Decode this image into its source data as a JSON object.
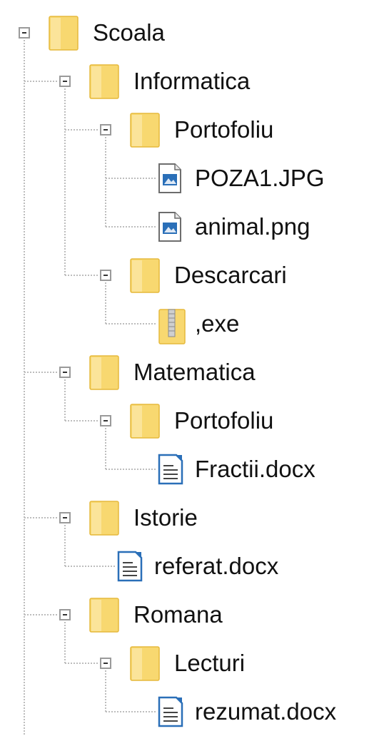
{
  "colors": {
    "folder": "#f8d870",
    "folder_dark": "#e6b93c",
    "tree_line": "#bdbdbd",
    "expander_border": "#9a9a9a",
    "text": "#111111",
    "image_icon": "#2a6fb8",
    "doc_icon": "#2a6fb8"
  },
  "tree": [
    {
      "label": "Scoala",
      "type": "folder",
      "depth": 0,
      "expanded": true
    },
    {
      "label": "Informatica",
      "type": "folder",
      "depth": 1,
      "expanded": true
    },
    {
      "label": "Portofoliu",
      "type": "folder",
      "depth": 2,
      "expanded": true
    },
    {
      "label": "POZA1.JPG",
      "type": "image",
      "depth": 3
    },
    {
      "label": "animal.png",
      "type": "image",
      "depth": 3
    },
    {
      "label": "Descarcari",
      "type": "folder",
      "depth": 2,
      "expanded": true
    },
    {
      "label": ",exe",
      "type": "archive",
      "depth": 3
    },
    {
      "label": "Matematica",
      "type": "folder",
      "depth": 1,
      "expanded": true
    },
    {
      "label": "Portofoliu",
      "type": "folder",
      "depth": 2,
      "expanded": true
    },
    {
      "label": "Fractii.docx",
      "type": "document",
      "depth": 3
    },
    {
      "label": "Istorie",
      "type": "folder",
      "depth": 1,
      "expanded": true
    },
    {
      "label": "referat.docx",
      "type": "document",
      "depth": 2
    },
    {
      "label": "Romana",
      "type": "folder",
      "depth": 1,
      "expanded": true
    },
    {
      "label": "Lecturi",
      "type": "folder",
      "depth": 2,
      "expanded": true
    },
    {
      "label": "rezumat.docx",
      "type": "document",
      "depth": 3
    }
  ]
}
